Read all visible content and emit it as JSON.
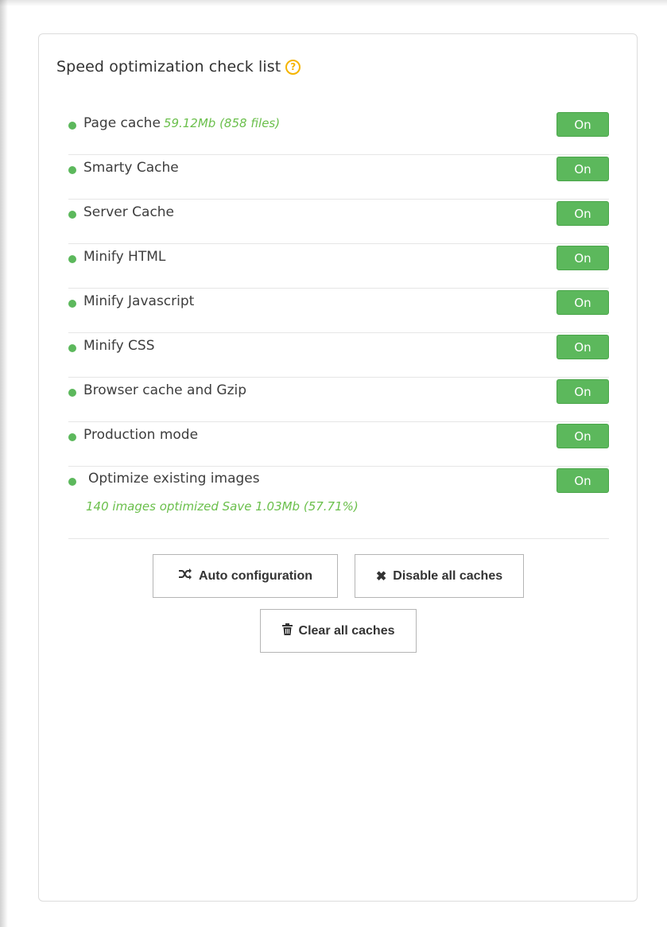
{
  "colors": {
    "accent_green": "#5cb85c",
    "info_green": "#6abf4b",
    "help_yellow": "#f5b400"
  },
  "panel": {
    "title": "Speed optimization check list",
    "help_icon": "question-circle-icon"
  },
  "checklist": [
    {
      "label": "Page cache",
      "info": "59.12Mb (858 files)",
      "status": "On"
    },
    {
      "label": "Smarty Cache",
      "status": "On"
    },
    {
      "label": "Server Cache",
      "status": "On"
    },
    {
      "label": "Minify HTML",
      "status": "On"
    },
    {
      "label": "Minify Javascript",
      "status": "On"
    },
    {
      "label": "Minify CSS",
      "status": "On"
    },
    {
      "label": "Browser cache and Gzip",
      "status": "On"
    },
    {
      "label": "Production mode",
      "status": "On"
    },
    {
      "label": "Optimize existing images",
      "subinfo": "140 images optimized  Save 1.03Mb (57.71%)",
      "status": "On"
    }
  ],
  "buttons": {
    "auto_config": {
      "label": "Auto configuration",
      "icon": "shuffle-icon"
    },
    "disable_all": {
      "label": "Disable all caches",
      "icon": "times-icon"
    },
    "clear_all": {
      "label": "Clear all caches",
      "icon": "trash-icon"
    }
  }
}
